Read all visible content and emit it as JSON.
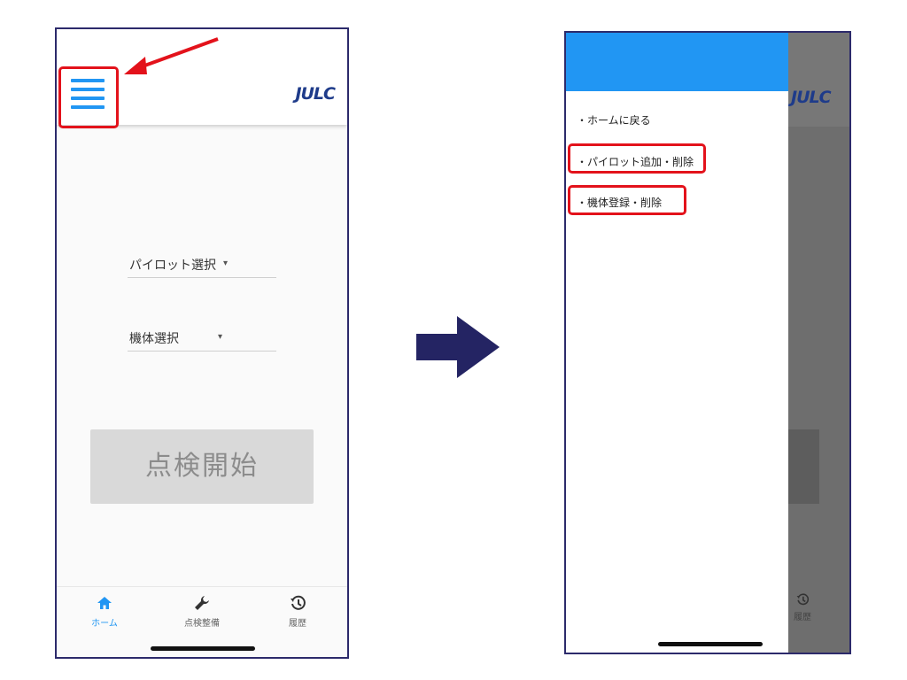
{
  "logo_text": "JULC",
  "left_screen": {
    "pilot_select": {
      "label": "パイロット選択",
      "caret": "▾"
    },
    "aircraft_select": {
      "label": "機体選択",
      "caret": "▾"
    },
    "start_button": "点検開始",
    "bottom_nav": [
      {
        "label": "ホーム",
        "icon": "home-icon",
        "active": true
      },
      {
        "label": "点検整備",
        "icon": "wrench-icon",
        "active": false
      },
      {
        "label": "履歴",
        "icon": "history-icon",
        "active": false
      }
    ]
  },
  "drawer": {
    "items": [
      {
        "label": "・ホームに戻る"
      },
      {
        "label": "・パイロット追加・削除"
      },
      {
        "label": "・機体登録・削除"
      }
    ]
  },
  "right_screen": {
    "nav_label": "履歴"
  },
  "colors": {
    "accent": "#2196f3",
    "highlight": "#e3121b",
    "frame": "#2c2a6b",
    "arrow": "#242463"
  }
}
